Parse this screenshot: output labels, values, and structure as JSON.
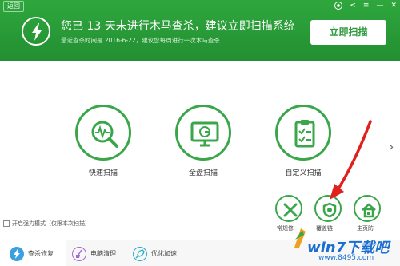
{
  "header": {
    "back_label": "返回",
    "main_message": "您已 13 天未进行木马查杀，建议立即扫描系统",
    "sub_message": "最近查杀时间是 2016-6-22，建议您每周进行一次木马查杀",
    "scan_now_label": "立即扫描",
    "bg_color": "#2fa73d"
  },
  "scan_modes": [
    {
      "label": "快速扫描",
      "icon": "magnifier-pulse-icon"
    },
    {
      "label": "全盘扫描",
      "icon": "monitor-icon"
    },
    {
      "label": "自定义扫描",
      "icon": "clipboard-check-icon"
    }
  ],
  "tools": [
    {
      "label": "常规修",
      "icon": "wrench-screwdriver-icon"
    },
    {
      "label": "覆盖链",
      "icon": "shield-recycle-icon"
    },
    {
      "label": "主页防",
      "icon": "home-lock-icon"
    }
  ],
  "power_mode_label": "开启强力模式（仅限本次扫描）",
  "bottom_tabs": [
    {
      "label": "查杀修复",
      "icon": "lightning-shield-icon",
      "active": true
    },
    {
      "label": "电脑清理",
      "icon": "broom-icon",
      "active": false
    },
    {
      "label": "优化加速",
      "icon": "rocket-icon",
      "active": false
    }
  ],
  "watermark": {
    "site": "win7下载吧",
    "url": "www.8495.com"
  },
  "accent_color": "#3aa64a",
  "annotation_color": "#e0201c"
}
